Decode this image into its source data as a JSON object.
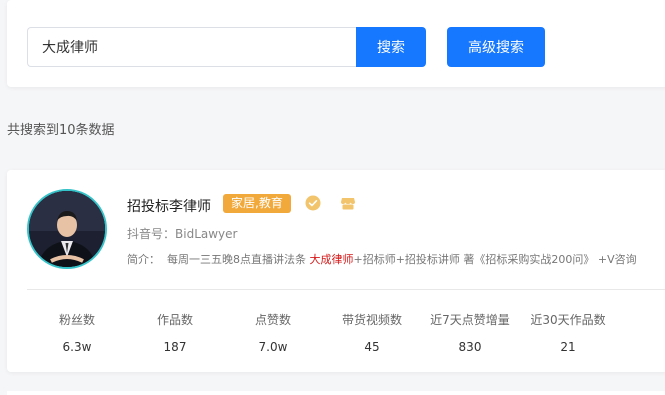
{
  "search": {
    "query": "大成律师",
    "search_label": "搜索",
    "advanced_label": "高级搜索"
  },
  "result_count_text": "共搜索到10条数据",
  "card": {
    "name": "招投标李律师",
    "tag": "家居,教育",
    "douyin_id_label": "抖音号：",
    "douyin_id": "BidLawyer",
    "intro_label": "简介：",
    "intro_before": "每周一三五晚8点直播讲法条 ",
    "intro_highlight": "大成律师",
    "intro_after": "+招标师+招投标讲师 著《招标采购实战200问》 +V咨询",
    "stats": [
      {
        "label": "粉丝数",
        "value": "6.3w"
      },
      {
        "label": "作品数",
        "value": "187"
      },
      {
        "label": "点赞数",
        "value": "7.0w"
      },
      {
        "label": "带货视频数",
        "value": "45"
      },
      {
        "label": "近7天点赞增量",
        "value": "830"
      },
      {
        "label": "近30天作品数",
        "value": "21"
      }
    ]
  },
  "colors": {
    "primary": "#1677ff",
    "tag": "#f2a93b",
    "highlight": "#d61818",
    "avatar_ring": "#35c2c8"
  },
  "icons": {
    "verify": "verified-check-icon",
    "store": "shop-icon"
  }
}
